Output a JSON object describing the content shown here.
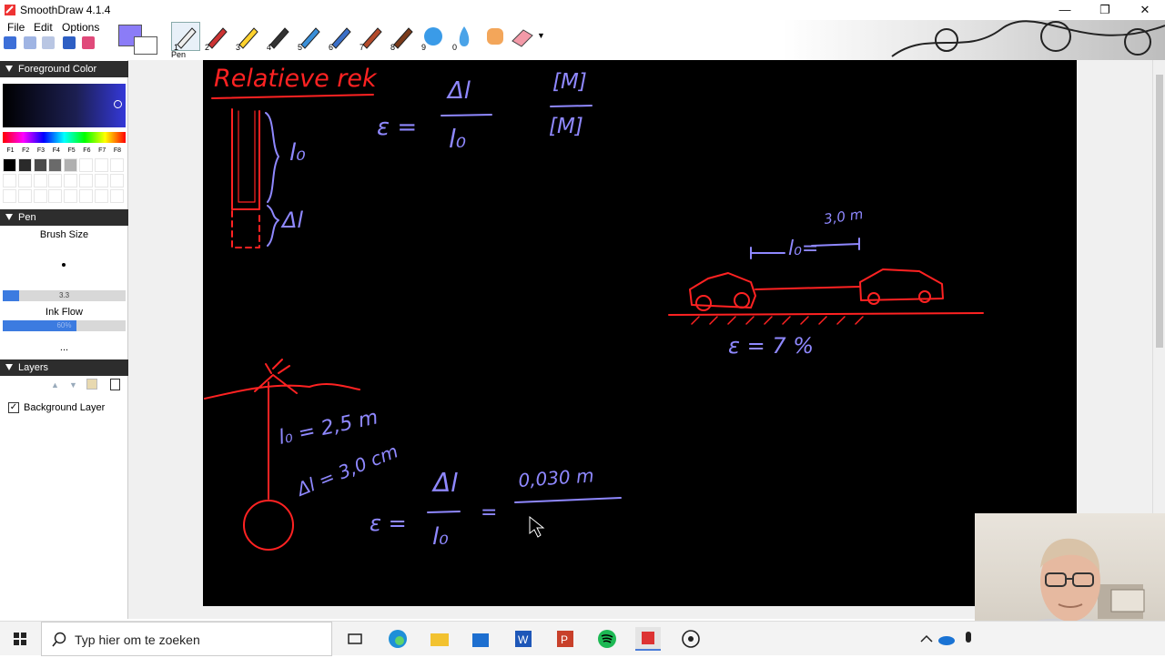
{
  "window": {
    "title": "SmoothDraw 4.1.4",
    "icon": "smoothdraw-app-icon",
    "buttons": [
      "minimize",
      "restore",
      "close"
    ]
  },
  "menu": [
    "File",
    "Edit",
    "Options"
  ],
  "toolbar": {
    "foreground_color": "#8b7cf7",
    "background_color": "#ffffff",
    "tools": [
      "1",
      "2",
      "3",
      "4",
      "5",
      "6",
      "7",
      "8",
      "9",
      "0"
    ],
    "active_tool_label": "Pen"
  },
  "panels": {
    "foreground": {
      "title": "Foreground Color",
      "fkeys": [
        "F1",
        "F2",
        "F3",
        "F4",
        "F5",
        "F6",
        "F7",
        "F8"
      ]
    },
    "pen": {
      "title": "Pen",
      "brush_size_label": "Brush Size",
      "brush_size_value": "3.3",
      "brush_size_fraction": 0.13,
      "ink_flow_label": "Ink Flow",
      "ink_flow_value": "60%",
      "ink_flow_fraction": 0.6,
      "more": "..."
    },
    "layers": {
      "title": "Layers",
      "items": [
        {
          "name": "Background Layer",
          "checked": true
        }
      ]
    }
  },
  "canvas": {
    "background": "#000000",
    "ink_red": "#ff2222",
    "ink_violet": "#8f88ff",
    "texts": {
      "heading": "Relatieve rek",
      "formula_eps": "ε =",
      "formula_num": "Δl",
      "formula_den": "l₀",
      "unit_num": "[M]",
      "unit_den": "[M]",
      "bracket_l0": "l₀",
      "bracket_dl": "Δl",
      "car_l0": "l₀=",
      "car_len": "3,0 m",
      "eps_result": "ε = 7 %",
      "rope_l0": "l₀ = 2,5 m",
      "rope_dl": "Δl = 3,0 cm",
      "calc_eps": "ε =",
      "calc_num": "Δl",
      "calc_den": "l₀",
      "calc_eq": "=",
      "calc_value": "0,030 m"
    }
  },
  "taskbar": {
    "search_placeholder": "Typ hier om te zoeken",
    "apps": [
      "task-view",
      "edge",
      "file-explorer",
      "microsoft-store",
      "word",
      "powerpoint",
      "spotify",
      "smoothdraw",
      "obs"
    ],
    "tray": [
      "chevron-up",
      "onedrive",
      "microphone"
    ]
  }
}
